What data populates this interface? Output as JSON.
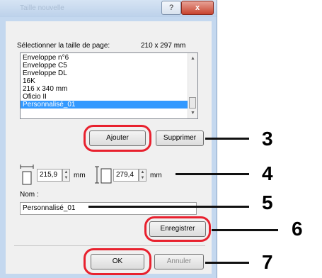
{
  "window": {
    "title": "Taille nouvelle"
  },
  "titlebar": {
    "help_label": "?",
    "close_label": "x"
  },
  "page_size": {
    "label": "Sélectionner la taille de page:",
    "value": "210 x 297 mm"
  },
  "list": {
    "items": [
      "Enveloppe n°6",
      "Enveloppe C5",
      "Enveloppe DL",
      "16K",
      "216 x 340 mm",
      "Oficio II",
      "Personnalisé_01"
    ],
    "selected": "Personnalisé_01"
  },
  "buttons": {
    "add": "Ajouter",
    "delete": "Supprimer",
    "save": "Enregistrer",
    "ok": "OK",
    "cancel": "Annuler"
  },
  "dimensions": {
    "width_value": "215,9",
    "height_value": "279,4",
    "unit": "mm"
  },
  "name": {
    "label": "Nom :",
    "value": "Personnalisé_01"
  },
  "callouts": [
    "3",
    "4",
    "5",
    "6",
    "7"
  ],
  "colors": {
    "highlight": "#e8212e",
    "selection": "#3399ff"
  }
}
